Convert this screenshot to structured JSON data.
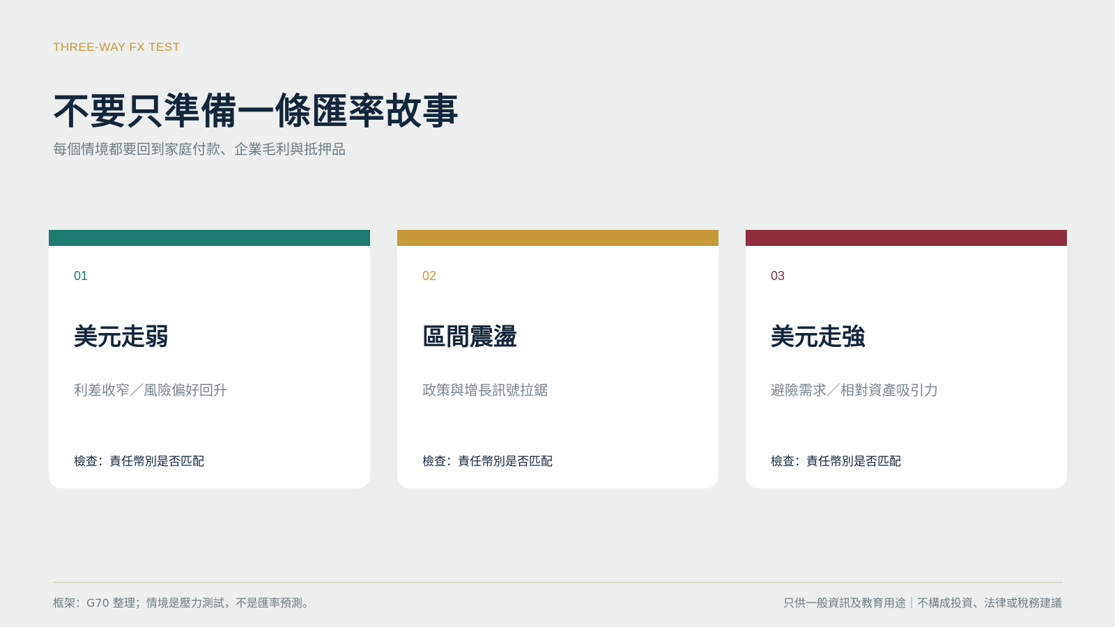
{
  "header": {
    "eyebrow": "THREE-WAY FX TEST",
    "title": "不要只準備一條匯率故事",
    "subtitle": "每個情境都要回到家庭付款、企業毛利與抵押品"
  },
  "colors": {
    "background": "#ECEFED",
    "accent_gold": "#C8993B",
    "scenario_1": "#1D7A6E",
    "scenario_2": "#C8993B",
    "scenario_3": "#8E2D3B",
    "ink": "#14263A",
    "muted": "#6E7C84"
  },
  "scenarios": [
    {
      "number": "01",
      "title": "美元走弱",
      "description": "利差收窄／風險偏好回升",
      "check": "檢查：責任幣別是否匹配"
    },
    {
      "number": "02",
      "title": "區間震盪",
      "description": "政策與增長訊號拉鋸",
      "check": "檢查：責任幣別是否匹配"
    },
    {
      "number": "03",
      "title": "美元走強",
      "description": "避險需求／相對資產吸引力",
      "check": "檢查：責任幣別是否匹配"
    }
  ],
  "footer": {
    "left": "框架：G70 整理；情境是壓力測試，不是匯率預測。",
    "right": "只供一般資訊及教育用途｜不構成投資、法律或稅務建議"
  }
}
